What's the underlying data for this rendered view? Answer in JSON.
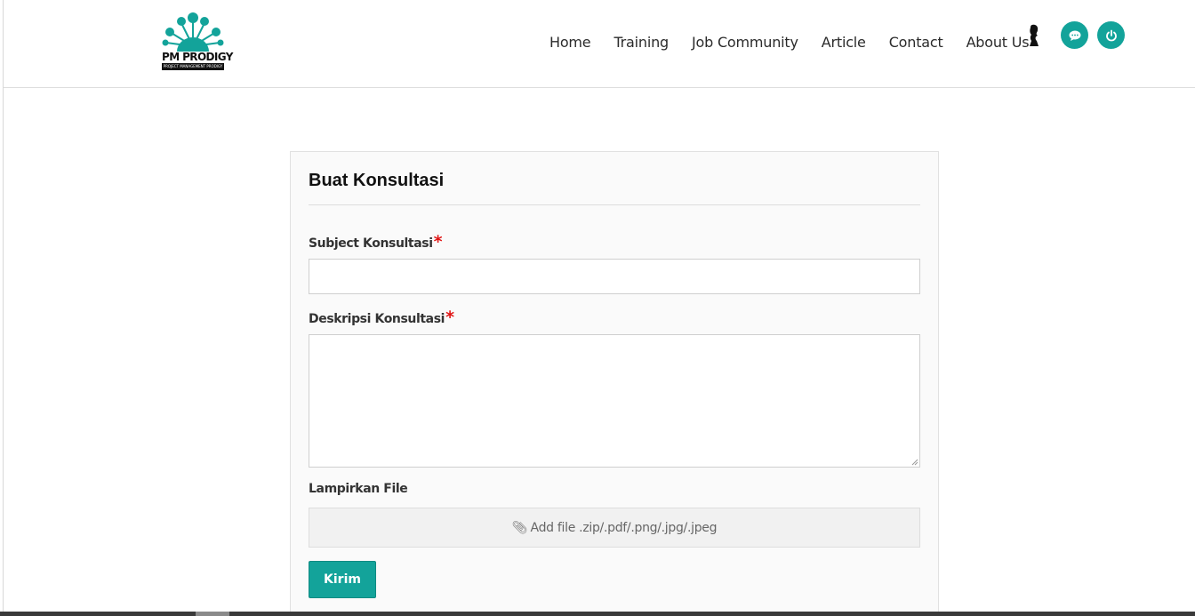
{
  "brand": {
    "name": "PM PRODIGY",
    "tagline": "PROJECT MANAGEMENT PRODIGY",
    "color": "#13a39a"
  },
  "nav": {
    "items": [
      {
        "label": "Home"
      },
      {
        "label": "Training"
      },
      {
        "label": "Job Community"
      },
      {
        "label": "Article"
      },
      {
        "label": "Contact"
      },
      {
        "label": "About Us"
      }
    ],
    "icons": [
      "profile-icon",
      "chat-icon",
      "power-icon"
    ]
  },
  "form": {
    "title": "Buat Konsultasi",
    "subject": {
      "label": "Subject Konsultasi",
      "required_mark": "*",
      "value": ""
    },
    "description": {
      "label": "Deskripsi Konsultasi",
      "required_mark": "*",
      "value": ""
    },
    "attachment": {
      "label": "Lampirkan File",
      "dropzone_text": "Add file .zip/.pdf/.png/.jpg/.jpeg",
      "icon": "paperclip-icon"
    },
    "submit_label": "Kirim"
  },
  "colors": {
    "accent": "#13a39a",
    "required": "#e01414"
  }
}
